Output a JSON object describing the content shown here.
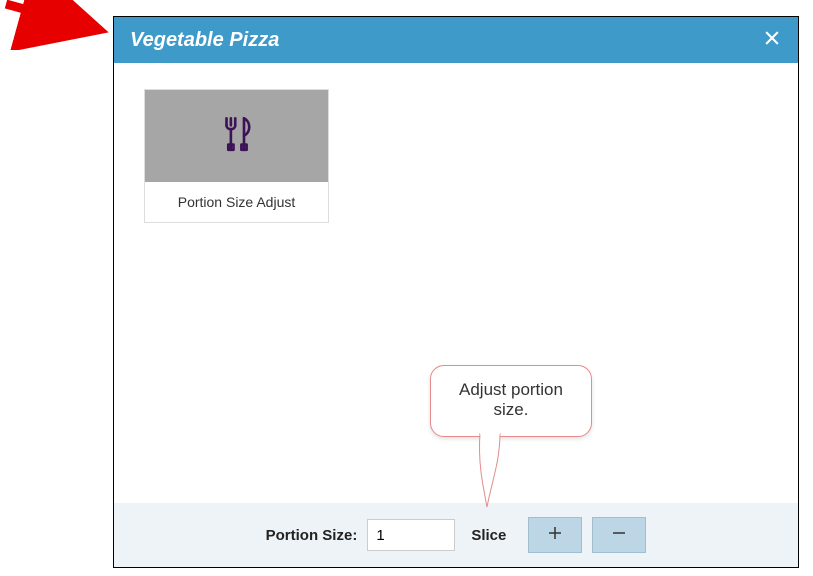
{
  "dialog": {
    "title": "Vegetable Pizza"
  },
  "card": {
    "label": "Portion Size Adjust",
    "icon": "utensils-icon"
  },
  "callout": {
    "text": "Adjust portion size."
  },
  "footer": {
    "portion_label": "Portion Size:",
    "portion_value": "1",
    "unit_label": "Slice"
  },
  "colors": {
    "header_bg": "#3d9ac9",
    "footer_bg": "#edf3f7",
    "step_btn_bg": "#bcd6e5",
    "callout_border": "#e58b8b",
    "arrow": "#e60000",
    "card_image_bg": "#a6a6a6",
    "icon_stroke": "#3d1358"
  }
}
